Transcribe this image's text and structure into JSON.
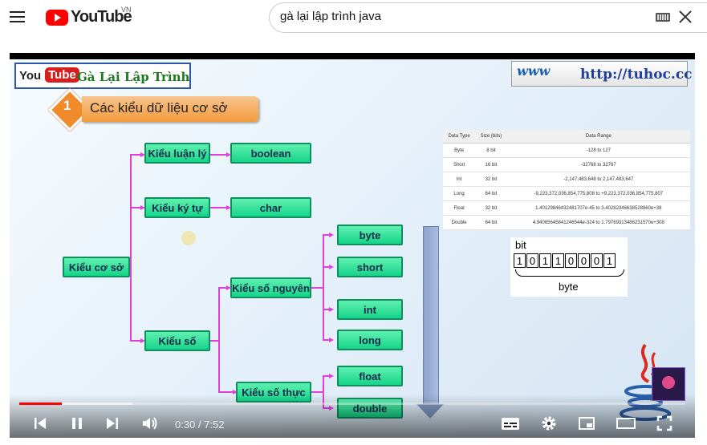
{
  "header": {
    "logo_text": "YouTube",
    "country_code": "VN",
    "search_value": "gà lại lập trình java"
  },
  "video": {
    "channel_you": "You",
    "channel_tube": "Tube",
    "channel_name": "Gà Lại Lập Trình",
    "site_www": "www",
    "site_url": "http://tuhoc.cc",
    "section_number": "1",
    "section_title": "Các kiểu dữ liệu cơ sở",
    "nodes": {
      "root": "Kiểu cơ sở",
      "logic": "Kiểu luận lý",
      "char_type": "Kiểu ký tự",
      "number": "Kiểu số",
      "integer": "Kiểu số nguyên",
      "real": "Kiểu số thực",
      "boolean": "boolean",
      "char": "char",
      "byte": "byte",
      "short": "short",
      "int": "int",
      "long": "long",
      "float": "float",
      "double": "double"
    },
    "table": {
      "headers": [
        "Data Type",
        "Size (bits)",
        "Data Range"
      ],
      "rows": [
        [
          "Byte",
          "8 bit",
          "-128 to 127"
        ],
        [
          "Short",
          "16 bit",
          "-32768 to 32767"
        ],
        [
          "Int",
          "32 bit",
          "-2,147,483,648 to 2,147,483,647"
        ],
        [
          "Long",
          "64 bit",
          "-9,223,372,036,854,775,808 to +9,223,372,036,854,775,807"
        ],
        [
          "Float",
          "32 bit",
          "1.40129846432481707e-45 to 3.40282346638528860e+38"
        ],
        [
          "Double",
          "64 bit",
          "4.94065645841246544e-324 to 1.79769313486231570e+308"
        ]
      ]
    },
    "bit_label": "bit",
    "bits": [
      "1",
      "0",
      "1",
      "1",
      "0",
      "0",
      "0",
      "1"
    ],
    "byte_label": "byte"
  },
  "player": {
    "time": "0:30 / 7:52",
    "progress": 0.064,
    "buffered": 0.17
  }
}
